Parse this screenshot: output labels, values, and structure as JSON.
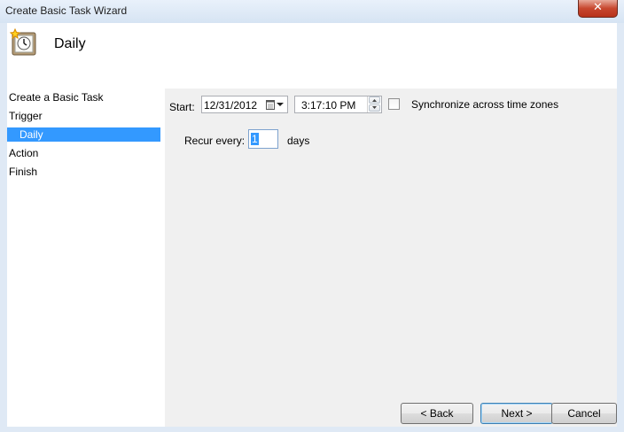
{
  "window": {
    "title": "Create Basic Task Wizard",
    "close_glyph": "✕"
  },
  "header": {
    "title": "Daily",
    "icon": "task-scheduler-clock-icon"
  },
  "nav": {
    "items": [
      {
        "label": "Create a Basic Task",
        "active": false
      },
      {
        "label": "Trigger",
        "active": false
      },
      {
        "label": "Daily",
        "active": true
      },
      {
        "label": "Action",
        "active": false
      },
      {
        "label": "Finish",
        "active": false
      }
    ]
  },
  "form": {
    "start_label": "Start:",
    "start_date": "12/31/2012",
    "start_time": "3:17:10 PM",
    "sync_label": "Synchronize across time zones",
    "sync_checked": false,
    "recur_label": "Recur every:",
    "recur_value": "1",
    "recur_unit": "days"
  },
  "buttons": {
    "back": "< Back",
    "next": "Next >",
    "cancel": "Cancel"
  },
  "colors": {
    "selection": "#3399ff",
    "client_bg": "#f0f0f0"
  }
}
